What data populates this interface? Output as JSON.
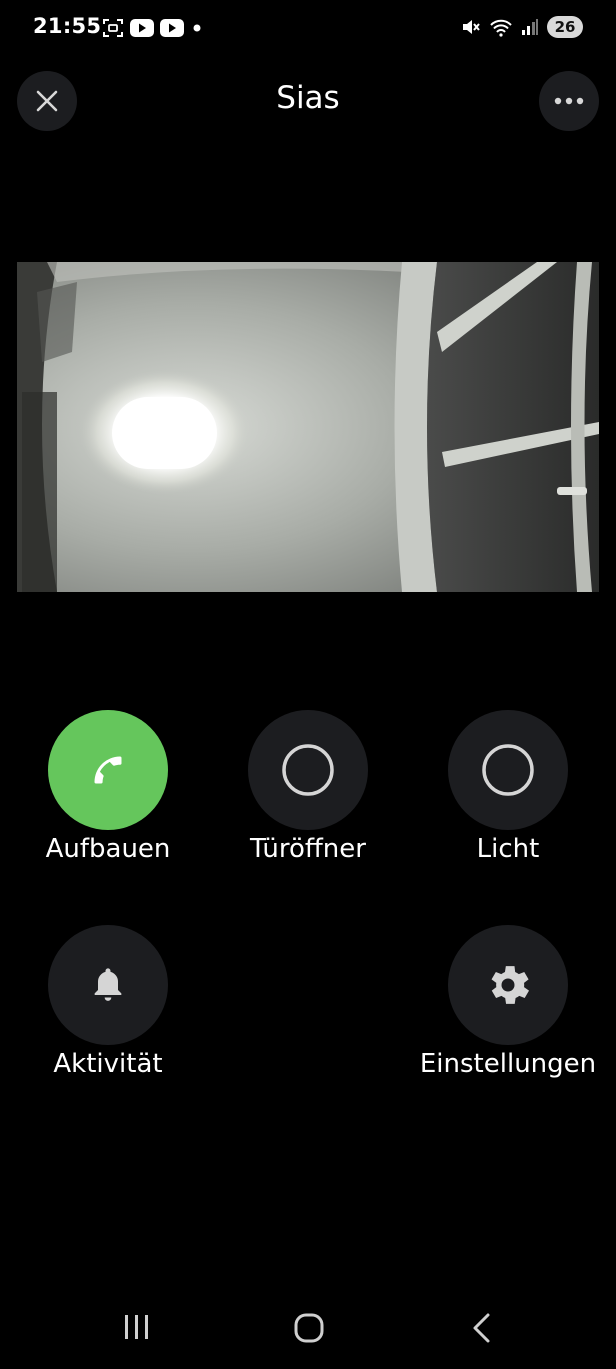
{
  "status_bar": {
    "time": "21:55",
    "battery": "26",
    "left_icons": [
      "screenshot-icon",
      "youtube-icon",
      "youtube-icon",
      "dot-icon"
    ],
    "right_icons": [
      "mute-icon",
      "wifi-icon",
      "signal-icon"
    ]
  },
  "header": {
    "title": "Sias",
    "close_icon": "close-icon",
    "more_icon": "more-icon"
  },
  "camera": {
    "description_name": "live-camera-feed"
  },
  "actions": [
    {
      "label": "Aufbauen",
      "icon": "phone-icon",
      "color": "#65c65c"
    },
    {
      "label": "Türöffner",
      "icon": "circle-icon",
      "color": "#1c1d20"
    },
    {
      "label": "Licht",
      "icon": "circle-icon",
      "color": "#1c1d20"
    },
    {
      "label": "Aktivität",
      "icon": "bell-icon",
      "color": "#1c1d20"
    },
    {
      "label": "Einstellungen",
      "icon": "gear-icon",
      "color": "#1c1d20"
    }
  ],
  "navbar": {
    "icons": [
      "recent-apps-icon",
      "home-icon",
      "back-icon"
    ]
  }
}
